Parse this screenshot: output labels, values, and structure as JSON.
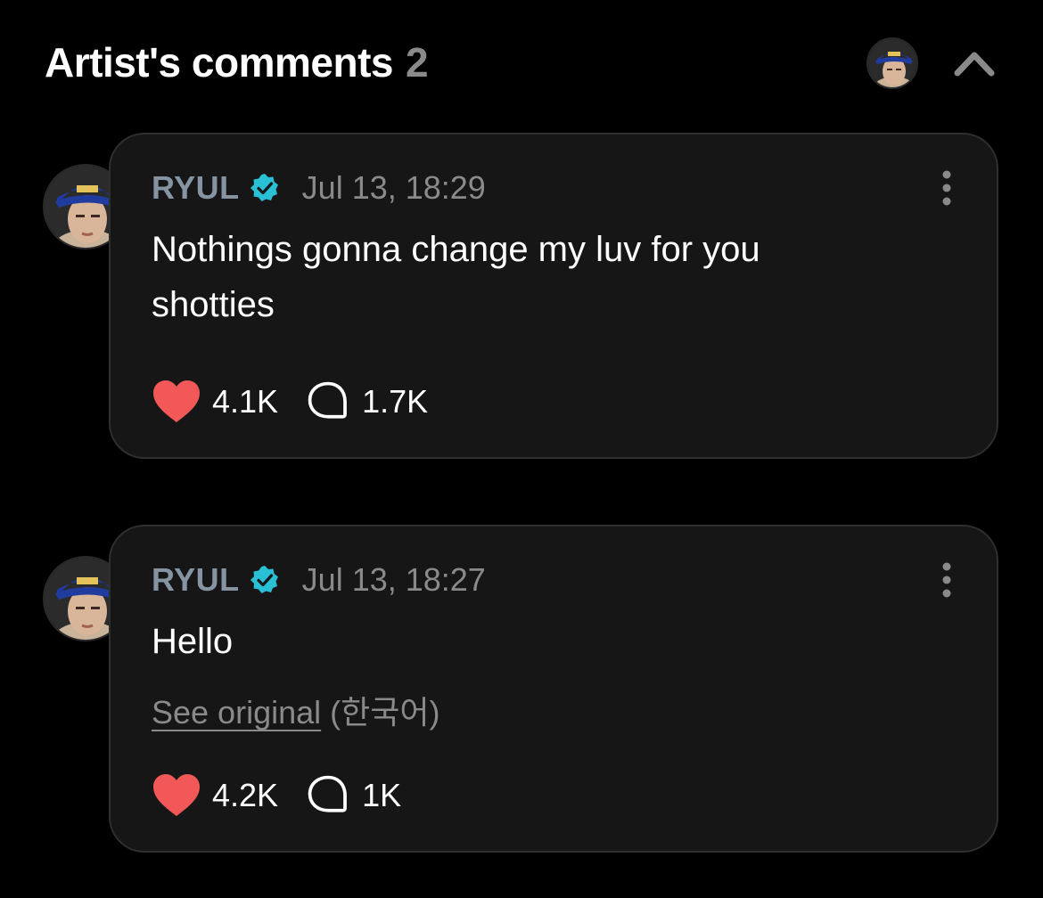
{
  "header": {
    "title": "Artist's comments",
    "count": "2"
  },
  "comments": [
    {
      "author": "RYUL",
      "timestamp": "Jul 13, 18:29",
      "text": "Nothings gonna change my luv for you shotties",
      "likes": "4.1K",
      "replies": "1.7K"
    },
    {
      "author": "RYUL",
      "timestamp": "Jul 13, 18:27",
      "text": "Hello",
      "see_original": "See original",
      "original_language": "(한국어)",
      "likes": "4.2K",
      "replies": "1K"
    }
  ],
  "colors": {
    "background": "#000000",
    "card": "#161616",
    "author": "#8693a3",
    "verified": "#29c0d6",
    "heart": "#f25858",
    "muted": "#8a8a8a"
  },
  "icons": {
    "verified": "verified-badge-icon",
    "heart": "heart-icon",
    "reply": "speech-bubble-icon",
    "more": "vertical-dots-icon",
    "collapse": "chevron-up-icon"
  }
}
